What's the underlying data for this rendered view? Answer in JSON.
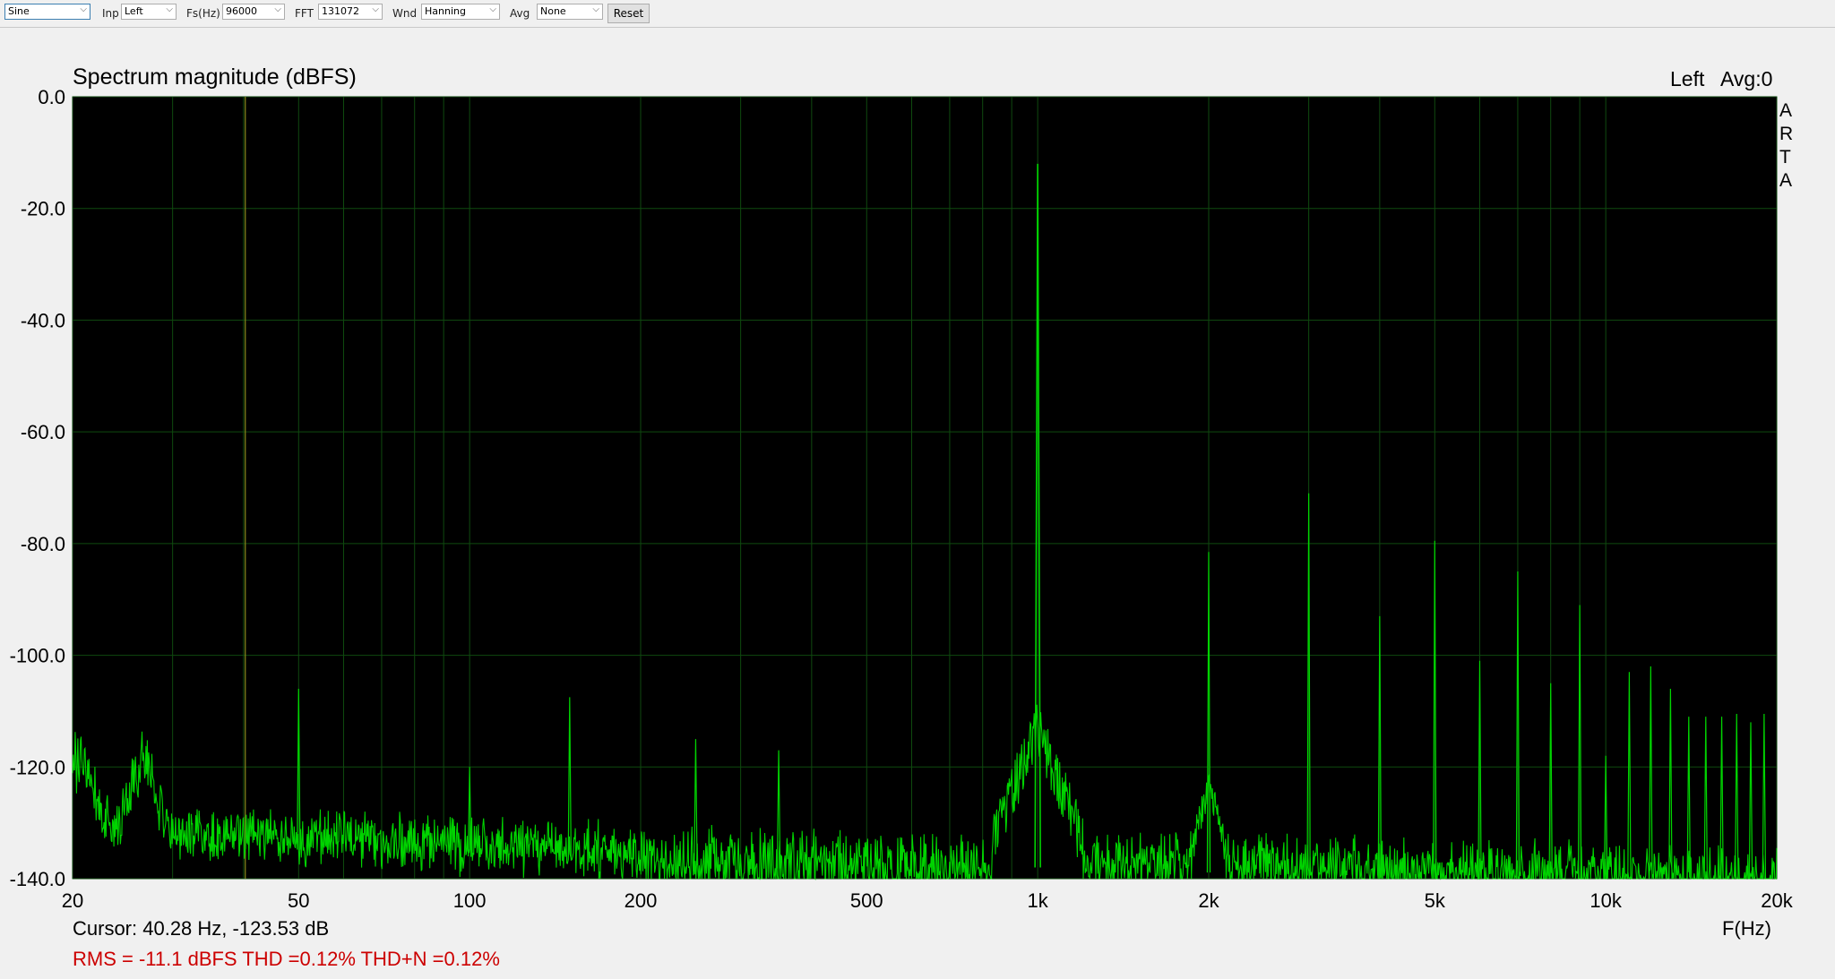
{
  "toolbar": {
    "generator": "Sine",
    "inp_label": "Inp",
    "inp_value": "Left",
    "fs_label": "Fs(Hz)",
    "fs_value": "96000",
    "fft_label": "FFT",
    "fft_value": "131072",
    "wnd_label": "Wnd",
    "wnd_value": "Hanning",
    "avg_label": "Avg",
    "avg_value": "None",
    "reset_label": "Reset"
  },
  "chart_data": {
    "type": "line",
    "title": "Spectrum magnitude (dBFS)",
    "channel_label": "Left",
    "avg_label": "Avg:0",
    "watermark": [
      "A",
      "R",
      "T",
      "A"
    ],
    "xlabel": "F(Hz)",
    "ylabel": "",
    "xscale": "log",
    "xlim": [
      20,
      20000
    ],
    "ylim": [
      -140,
      0
    ],
    "grid": true,
    "ytick_labels": [
      "0.0",
      "-20.0",
      "-40.0",
      "-60.0",
      "-80.0",
      "-100.0",
      "-120.0",
      "-140.0"
    ],
    "ytick_values": [
      0,
      -20,
      -40,
      -60,
      -80,
      -100,
      -120,
      -140
    ],
    "xtick_labels": [
      "20",
      "50",
      "100",
      "200",
      "500",
      "1k",
      "2k",
      "5k",
      "10k",
      "20k"
    ],
    "xtick_values": [
      20,
      50,
      100,
      200,
      500,
      1000,
      2000,
      5000,
      10000,
      20000
    ],
    "cursor_freq": 40.28,
    "cursor_text": "Cursor: 40.28 Hz, -123.53 dB",
    "summary_text": "RMS =  -11.1 dBFS THD =0.12% THD+N =0.12%",
    "series": [
      {
        "peaks": [
          {
            "f": 50,
            "db": -106
          },
          {
            "f": 100,
            "db": -120
          },
          {
            "f": 150,
            "db": -107.5
          },
          {
            "f": 250,
            "db": -115
          },
          {
            "f": 350,
            "db": -117
          },
          {
            "f": 1000,
            "db": -12
          },
          {
            "f": 2000,
            "db": -81.5
          },
          {
            "f": 3000,
            "db": -71
          },
          {
            "f": 4000,
            "db": -93
          },
          {
            "f": 5000,
            "db": -79.5
          },
          {
            "f": 6000,
            "db": -101
          },
          {
            "f": 7000,
            "db": -85
          },
          {
            "f": 8000,
            "db": -105
          },
          {
            "f": 9000,
            "db": -91
          },
          {
            "f": 10000,
            "db": -118
          },
          {
            "f": 11000,
            "db": -103
          },
          {
            "f": 12000,
            "db": -102
          },
          {
            "f": 13000,
            "db": -106
          },
          {
            "f": 14000,
            "db": -111
          },
          {
            "f": 15000,
            "db": -111
          },
          {
            "f": 16000,
            "db": -111
          },
          {
            "f": 17000,
            "db": -110.5
          },
          {
            "f": 18000,
            "db": -112
          },
          {
            "f": 19000,
            "db": -110.5
          }
        ]
      }
    ],
    "colors": {
      "trace": "#00d400",
      "plot_bg": "#000000",
      "grid": "#0f4a0f",
      "cursor": "#8a8a1a",
      "summary": "#cc0000"
    }
  }
}
